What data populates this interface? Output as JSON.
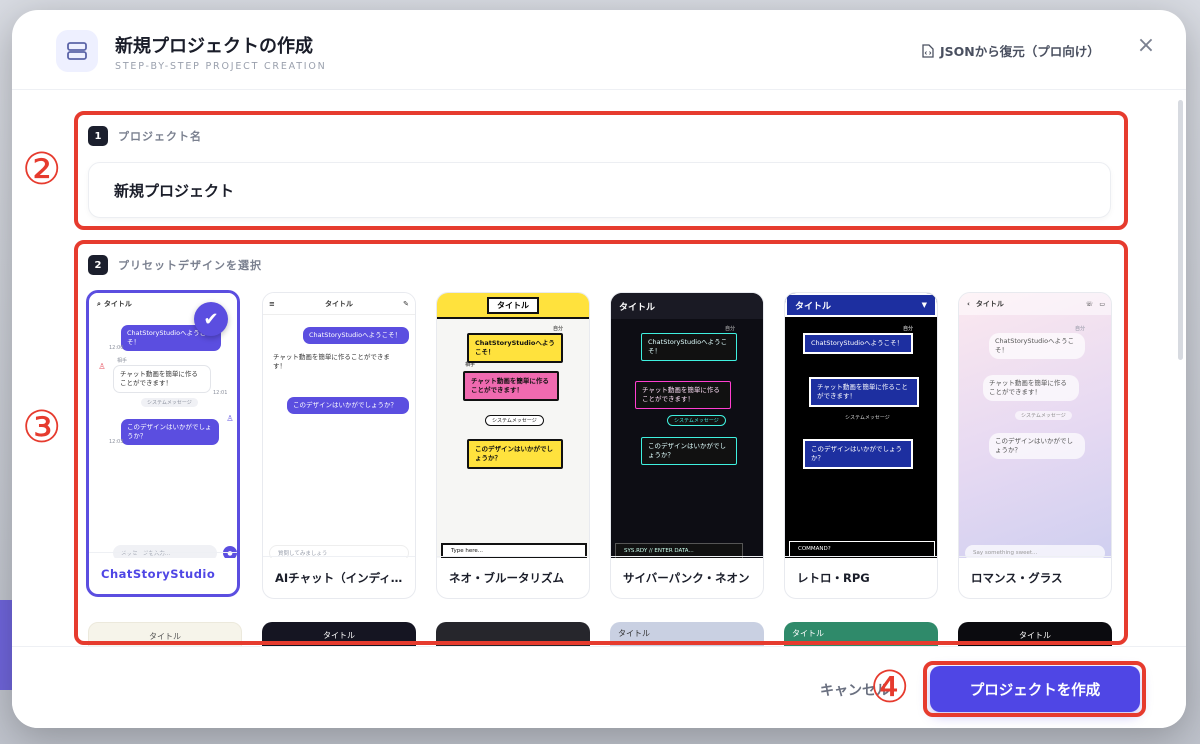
{
  "header": {
    "title": "新規プロジェクトの作成",
    "subtitle": "STEP-BY-STEP PROJECT CREATION",
    "restore_label": "JSONから復元（プロ向け）",
    "close_symbol": "×"
  },
  "step1": {
    "number": "1",
    "label": "プロジェクト名",
    "value": "新規プロジェクト"
  },
  "step2": {
    "number": "2",
    "label": "プリセットデザインを選択"
  },
  "annotations": {
    "a2": "②",
    "a3": "③",
    "a4": "④"
  },
  "presets": [
    {
      "name": "ChatStoryStudio",
      "selected": true,
      "title": "タイトル",
      "msg1": "ChatStoryStudioへようこそ！",
      "sender": "相手",
      "msg2": "チャット動画を簡単に作ることができます！",
      "system": "システムメッセージ",
      "msg3": "このデザインはいかがでしょうか？",
      "input": "メッセージを入力...",
      "time1": "12:00",
      "time2": "12:01",
      "time3": "12:03"
    },
    {
      "name": "AIチャット（インディ…",
      "title": "タイトル",
      "msg1": "ChatStoryStudioへようこそ！",
      "msg2": "チャット動画を簡単に作ることができます！",
      "msg3": "このデザインはいかがでしょうか？",
      "input": "質問してみましょう"
    },
    {
      "name": "ネオ・ブルータリズム",
      "title": "タイトル",
      "self": "自分",
      "sender": "相手",
      "msg1": "ChatStoryStudioへようこそ！",
      "msg2": "チャット動画を簡単に作ることができます！",
      "system": "システムメッセージ",
      "msg3": "このデザインはいかがでしょうか？",
      "input": "Type here..."
    },
    {
      "name": "サイバーパンク・ネオン",
      "title": "タイトル",
      "self": "自分",
      "msg1": "ChatStoryStudioへようこそ！",
      "msg2": "チャット動画を簡単に作ることができます！",
      "system": "システムメッセージ",
      "msg3": "このデザインはいかがでしょうか？",
      "input": "SYS.RDY // ENTER DATA..."
    },
    {
      "name": "レトロ・RPG",
      "title": "タイトル",
      "self": "自分",
      "msg1": "ChatStoryStudioへようこそ！",
      "msg2": "チャット動画を簡単に作ることができます！",
      "system": "システムメッセージ",
      "msg3": "このデザインはいかがでしょうか？",
      "input": "COMMAND?"
    },
    {
      "name": "ロマンス・グラス",
      "title": "タイトル",
      "self": "自分",
      "msg1": "ChatStoryStudioへようこそ！",
      "msg2": "チャット動画を簡単に作ることができます！",
      "system": "システムメッセージ",
      "msg3": "このデザインはいかがでしょうか？",
      "input": "Say something sweet..."
    }
  ],
  "row2_titles": [
    "タイトル",
    "タイトル",
    "",
    "タイトル",
    "タイトル",
    "タイトル"
  ],
  "footer": {
    "cancel_label": "キャンセル",
    "create_label": "プロジェクトを作成"
  },
  "colors": {
    "accent": "#4f46e5",
    "annotation": "#e63b2e"
  }
}
